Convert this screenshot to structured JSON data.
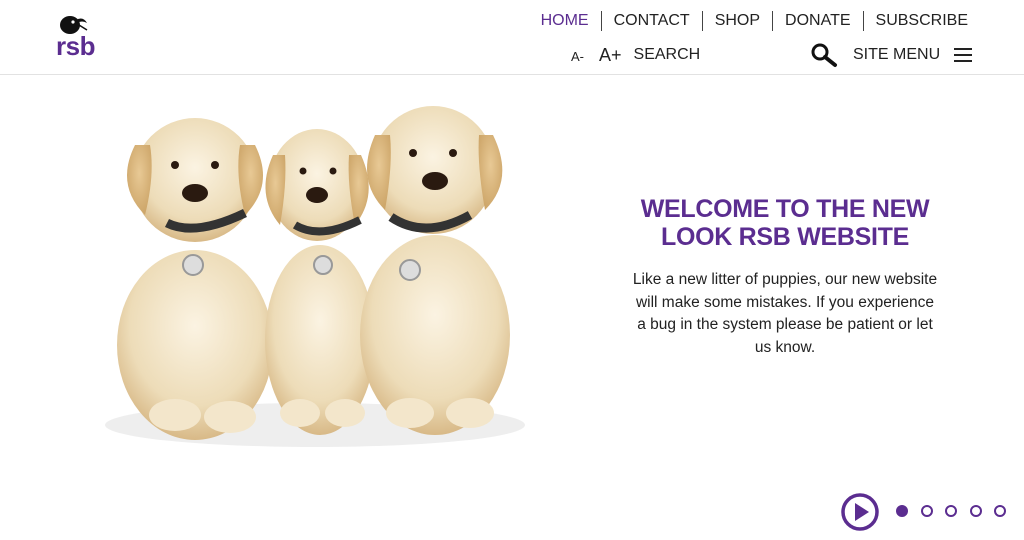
{
  "brand": {
    "logo_text": "rsb",
    "color": "#5b2d90"
  },
  "nav": {
    "items": [
      {
        "label": "HOME",
        "active": true
      },
      {
        "label": "CONTACT",
        "active": false
      },
      {
        "label": "SHOP",
        "active": false
      },
      {
        "label": "DONATE",
        "active": false
      },
      {
        "label": "SUBSCRIBE",
        "active": false
      }
    ]
  },
  "toolbar": {
    "font_decrease": "A-",
    "font_increase": "A+",
    "search_label": "SEARCH",
    "search_icon": "search-icon",
    "site_menu_label": "SITE MENU",
    "menu_icon": "hamburger-menu-icon"
  },
  "hero": {
    "image_description_icon": "puppies-photo",
    "heading": "WELCOME TO THE NEW LOOK RSB WEBSITE",
    "body": "Like a new litter of puppies, our new website will make some mistakes. If you experience a bug in the system please be patient or let us know."
  },
  "carousel": {
    "play_icon": "play-icon",
    "slide_count": 5,
    "active_slide": 1
  }
}
